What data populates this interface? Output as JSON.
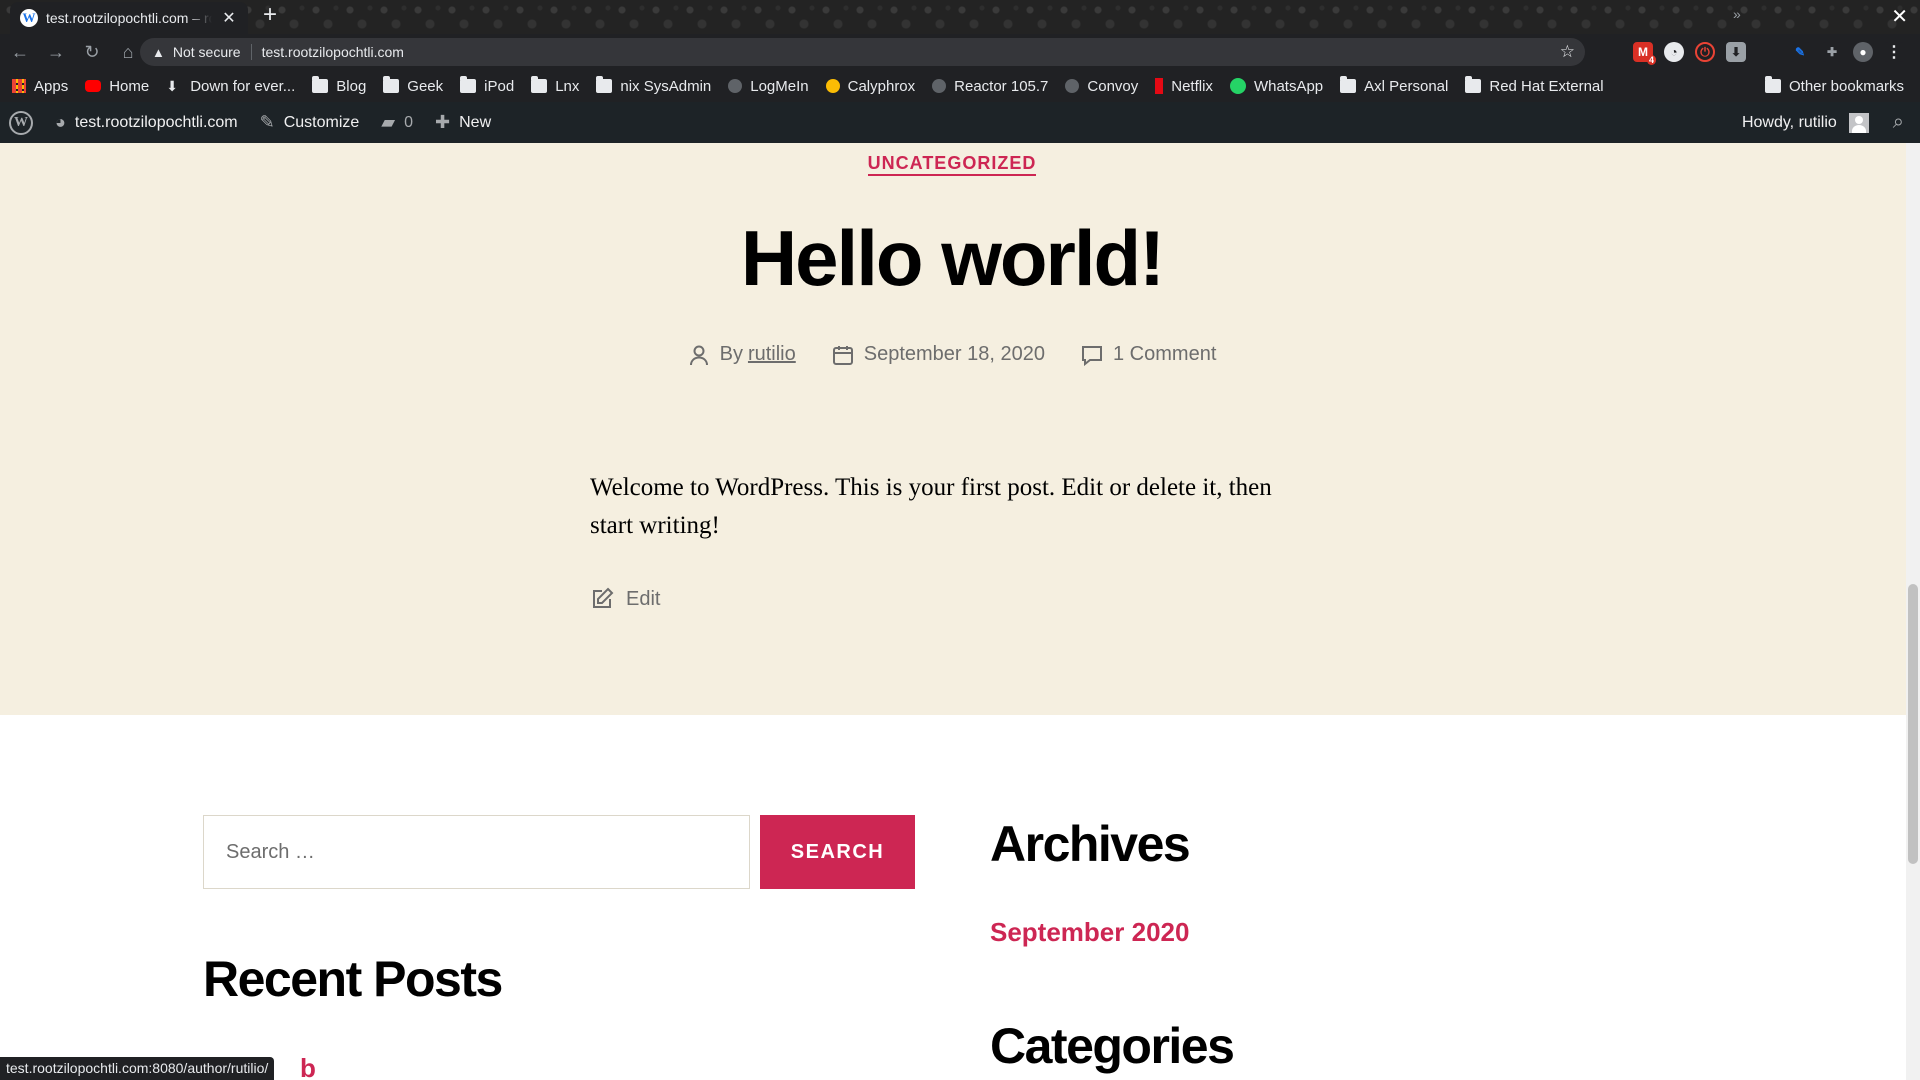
{
  "browser": {
    "tab_title": "test.rootzilopochtli.com – rootzilopochtli",
    "tab_favicon_letter": "W",
    "not_secure": "Not secure",
    "url": "test.rootzilopochtli.com",
    "notification_count": "4",
    "status_url": "test.rootzilopochtli.com:8080/author/rutilio/"
  },
  "bookmarks": [
    {
      "label": "Apps",
      "icon": "apps-grid-icon"
    },
    {
      "label": "Home",
      "icon": "youtube-icon"
    },
    {
      "label": "Down for ever...",
      "icon": "down-arrow-icon"
    },
    {
      "label": "Blog",
      "icon": "folder-icon"
    },
    {
      "label": "Geek",
      "icon": "folder-icon"
    },
    {
      "label": "iPod",
      "icon": "folder-icon"
    },
    {
      "label": "Lnx",
      "icon": "folder-icon"
    },
    {
      "label": "nix SysAdmin",
      "icon": "folder-icon"
    },
    {
      "label": "LogMeIn",
      "icon": "globe-icon"
    },
    {
      "label": "Calyphrox",
      "icon": "calyphrox-icon"
    },
    {
      "label": "Reactor 105.7",
      "icon": "globe-icon"
    },
    {
      "label": "Convoy",
      "icon": "globe-icon"
    },
    {
      "label": "Netflix",
      "icon": "netflix-icon"
    },
    {
      "label": "WhatsApp",
      "icon": "whatsapp-icon"
    },
    {
      "label": "Axl Personal",
      "icon": "folder-icon"
    },
    {
      "label": "Red Hat External",
      "icon": "folder-icon"
    }
  ],
  "other_bookmarks": "Other bookmarks",
  "adminbar": {
    "site": "test.rootzilopochtli.com",
    "customize": "Customize",
    "comments_count": "0",
    "new": "New",
    "howdy": "Howdy, rutilio"
  },
  "post": {
    "category": "UNCATEGORIZED",
    "title": "Hello world!",
    "by": "By",
    "author": "rutilio",
    "date": "September 18, 2020",
    "comments": "1 Comment",
    "body": "Welcome to WordPress. This is your first post. Edit or delete it, then start writing!",
    "edit": "Edit"
  },
  "widgets": {
    "search_placeholder": "Search …",
    "search_button": "SEARCH",
    "recent_posts_heading": "Recent Posts",
    "archives_heading": "Archives",
    "archive_link": "September 2020",
    "categories_heading": "Categories",
    "recent_post_partial": "b"
  },
  "colors": {
    "accent": "#cd2653",
    "post_background": "#f5efe0",
    "adminbar": "#1d2327"
  }
}
